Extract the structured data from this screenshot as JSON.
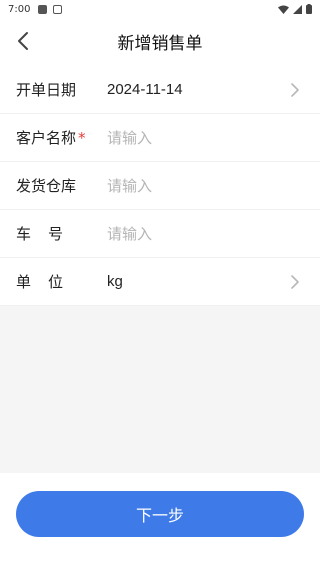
{
  "status_bar": {
    "time": "7:00"
  },
  "header": {
    "title": "新增销售单"
  },
  "form": {
    "rows": [
      {
        "label": "开单日期",
        "value": "2024-11-14"
      },
      {
        "label": "客户名称",
        "required_mark": "*",
        "placeholder": "请输入"
      },
      {
        "label": "发货仓库",
        "placeholder": "请输入"
      },
      {
        "label": "车号",
        "placeholder": "请输入"
      },
      {
        "label": "单位",
        "value": "kg"
      }
    ]
  },
  "footer": {
    "next_label": "下一步"
  },
  "colors": {
    "primary": "#3e7ae8",
    "required": "#e83a3a",
    "placeholder": "#b5b5b5"
  }
}
